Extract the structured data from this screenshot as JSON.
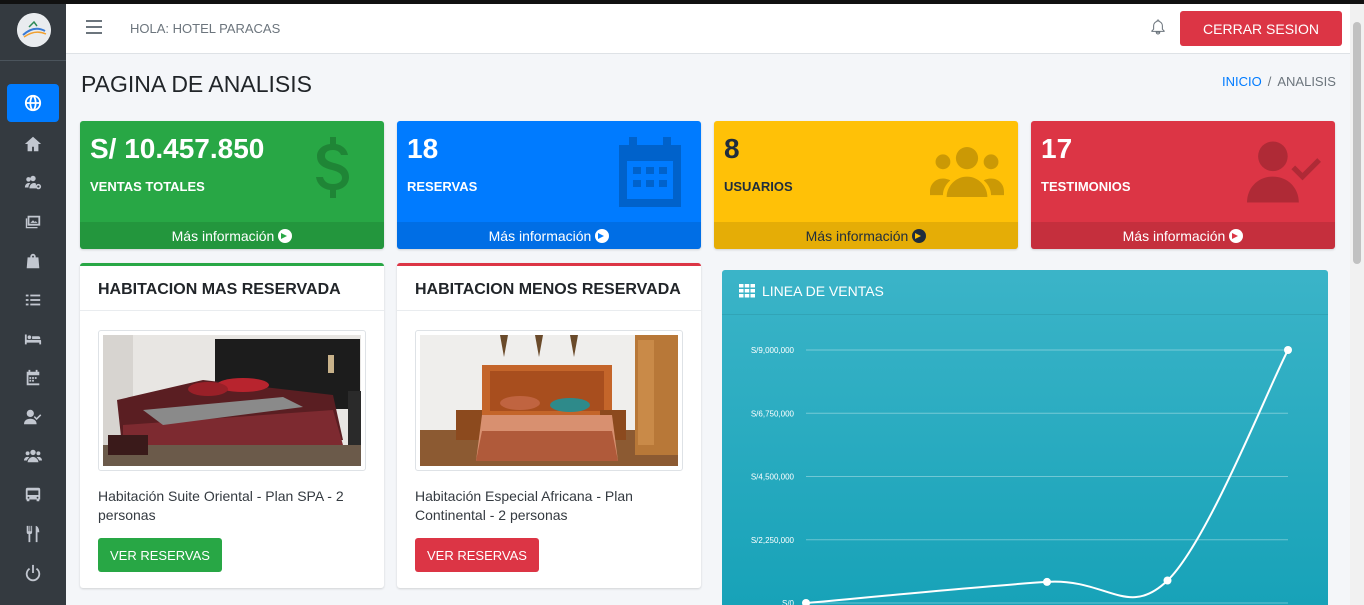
{
  "header": {
    "greeting": "HOLA: HOTEL PARACAS",
    "logout_label": "CERRAR SESION"
  },
  "sidebar": {
    "items": [
      {
        "icon": "globe-icon",
        "active": true
      },
      {
        "icon": "home-icon",
        "active": false
      },
      {
        "icon": "users-cog-icon",
        "active": false
      },
      {
        "icon": "images-icon",
        "active": false
      },
      {
        "icon": "shopping-bag-icon",
        "active": false
      },
      {
        "icon": "list-icon",
        "active": false
      },
      {
        "icon": "bed-icon",
        "active": false
      },
      {
        "icon": "calendar-icon",
        "active": false
      },
      {
        "icon": "user-check-icon",
        "active": false
      },
      {
        "icon": "users-icon",
        "active": false
      },
      {
        "icon": "bus-icon",
        "active": false
      },
      {
        "icon": "utensils-icon",
        "active": false
      },
      {
        "icon": "power-icon",
        "active": false
      }
    ]
  },
  "page": {
    "title": "PAGINA DE ANALISIS",
    "breadcrumb_home": "INICIO",
    "breadcrumb_sep": "/",
    "breadcrumb_current": "ANALISIS"
  },
  "stats": [
    {
      "value": "S/ 10.457.850",
      "label": "VENTAS TOTALES",
      "more": "Más información",
      "color": "#28a745",
      "icon": "dollar-icon"
    },
    {
      "value": "18",
      "label": "RESERVAS",
      "more": "Más información",
      "color": "#007bff",
      "icon": "calendar-icon"
    },
    {
      "value": "8",
      "label": "USUARIOS",
      "more": "Más información",
      "color": "#ffc107",
      "icon": "users-icon"
    },
    {
      "value": "17",
      "label": "TESTIMONIOS",
      "more": "Más información",
      "color": "#dc3545",
      "icon": "user-check-icon"
    }
  ],
  "rooms": [
    {
      "title": "HABITACION MAS RESERVADA",
      "name": "Habitación Suite Oriental - Plan SPA - 2 personas",
      "button": "VER RESERVAS",
      "accent": "#28a745"
    },
    {
      "title": "HABITACION MENOS RESERVADA",
      "name": "Habitación Especial Africana - Plan Continental - 2 personas",
      "button": "VER RESERVAS",
      "accent": "#dc3545"
    }
  ],
  "chart": {
    "title": "LINEA DE VENTAS"
  },
  "chart_data": {
    "type": "line",
    "title": "LINEA DE VENTAS",
    "y_ticks": [
      "S/0",
      "S/2,250,000",
      "S/4,500,000",
      "S/6,750,000",
      "S/9,000,000"
    ],
    "ylim": [
      0,
      9000000
    ],
    "grid": true,
    "series": [
      {
        "values": [
          0,
          750000,
          800000,
          9000000
        ]
      }
    ],
    "x_positions": [
      0,
      2,
      3,
      4
    ]
  }
}
